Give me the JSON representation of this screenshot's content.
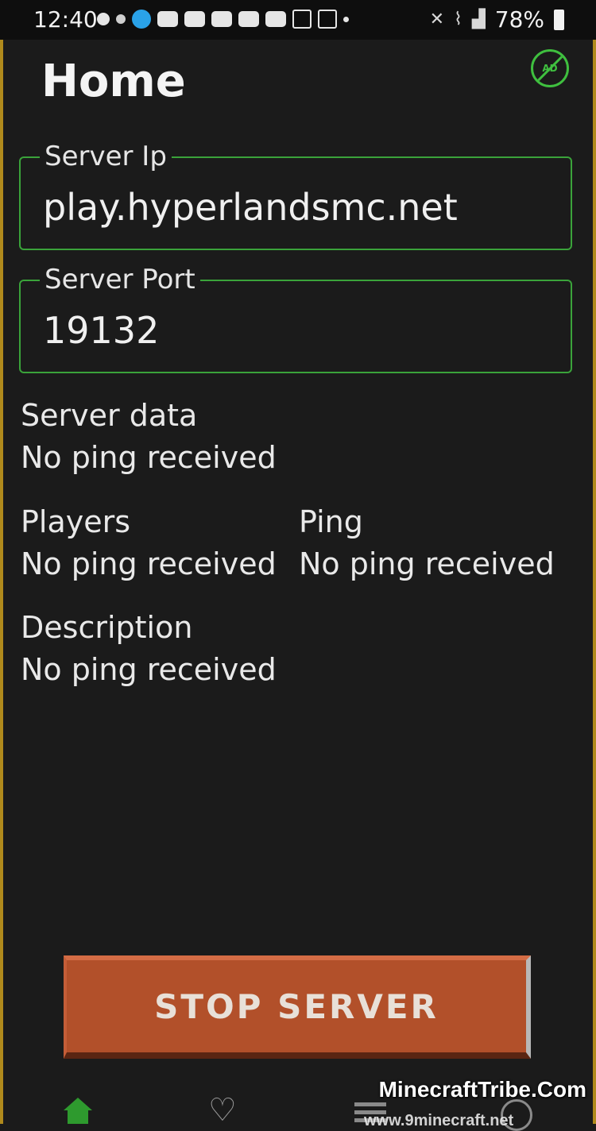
{
  "status_bar": {
    "time": "12:40",
    "battery": "78%"
  },
  "header": {
    "title": "Home",
    "ad_icon_label": "AD"
  },
  "form": {
    "server_ip": {
      "label": "Server Ip",
      "value": "play.hyperlandsmc.net"
    },
    "server_port": {
      "label": "Server Port",
      "value": "19132"
    }
  },
  "info": {
    "server_data": {
      "label": "Server data",
      "value": "No ping received"
    },
    "players": {
      "label": "Players",
      "value": "No ping received"
    },
    "ping": {
      "label": "Ping",
      "value": "No ping received"
    },
    "description": {
      "label": "Description",
      "value": "No ping received"
    }
  },
  "actions": {
    "stop_label": "STOP SERVER"
  },
  "bottom_nav": {
    "items": [
      "home-icon",
      "heart-icon",
      "list-icon",
      "help-icon"
    ],
    "active_color": "#2e9a2e"
  },
  "watermark": {
    "text": "MinecraftTribe.Com",
    "subtext": "www.9minecraft.net"
  },
  "colors": {
    "background": "#1b1b1b",
    "accent_green": "#3aa33a",
    "stop_button": "#b2502a"
  }
}
